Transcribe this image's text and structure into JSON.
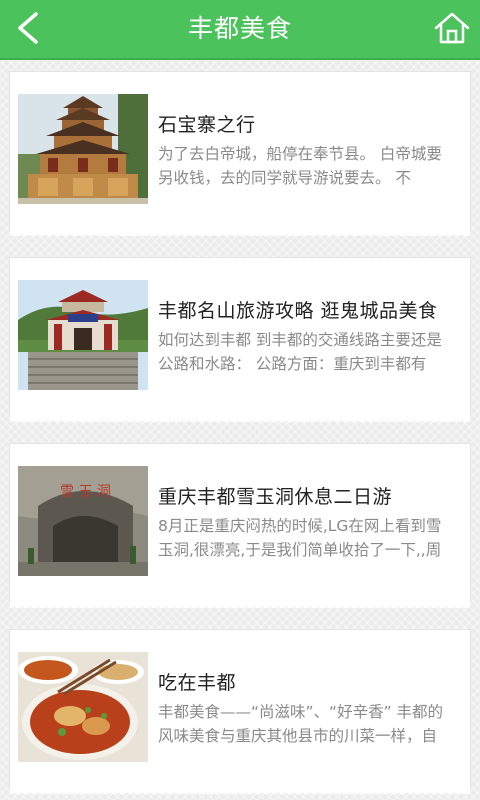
{
  "header": {
    "title": "丰都美食",
    "back_icon": "chevron-left-icon",
    "home_icon": "home-icon",
    "bar_color": "#4cc25c"
  },
  "articles": [
    {
      "title": "石宝寨之行",
      "desc": "为了去白帝城，船停在奉节县。 白帝城要另收钱，去的同学就导游说要去。 不",
      "image": "pagoda-photo"
    },
    {
      "title": "丰都名山旅游攻略 逛鬼城品美食",
      "desc": "如何达到丰都 到丰都的交通线路主要还是公路和水路： 公路方面：重庆到丰都有",
      "image": "temple-gate-photo"
    },
    {
      "title": "重庆丰都雪玉洞休息二日游",
      "desc": "8月正是重庆闷热的时候,LG在网上看到雪玉洞,很漂亮,于是我们简单收拾了一下,,周",
      "image": "cave-entrance-photo"
    },
    {
      "title": "吃在丰都",
      "desc": "丰都美食——“尚滋味”、“好辛香” 丰都的风味美食与重庆其他县市的川菜一样，自",
      "image": "noodle-bowl-photo"
    }
  ]
}
